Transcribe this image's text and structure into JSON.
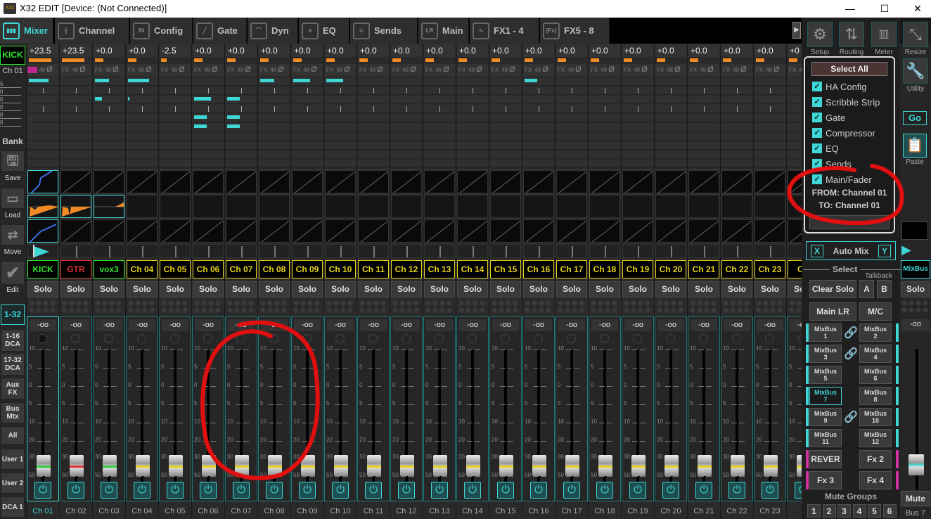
{
  "window": {
    "title": "X32 EDIT [Device: (Not Connected)]",
    "app_icon_text": "X32 EDIT",
    "minimize": "—",
    "maximize": "☐",
    "close": "✕"
  },
  "tabs": [
    {
      "label": "Mixer",
      "icon": "mixer-icon",
      "glyph": "▮▮▮",
      "active": true
    },
    {
      "label": "Channel",
      "icon": "channel-icon",
      "glyph": "╫"
    },
    {
      "label": "Config",
      "icon": "config-icon",
      "glyph": "IN"
    },
    {
      "label": "Gate",
      "icon": "gate-icon",
      "glyph": "╱"
    },
    {
      "label": "Dyn",
      "icon": "dyn-icon",
      "glyph": "⌒"
    },
    {
      "label": "EQ",
      "icon": "eq-icon",
      "glyph": "∧"
    },
    {
      "label": "Sends",
      "icon": "sends-icon",
      "glyph": "╪"
    },
    {
      "label": "Main",
      "icon": "main-icon",
      "glyph": "LR"
    },
    {
      "label": "FX1 - 4",
      "icon": "fx-wave-icon",
      "glyph": "∿"
    },
    {
      "label": "FX5 - 8",
      "icon": "fx-icon",
      "glyph": "(Fx)"
    }
  ],
  "sidebar": {
    "selected_name": "KICK",
    "selected_channel": "Ch 01",
    "meter_labels": [
      "5",
      "0",
      "0",
      "0",
      "0",
      "0"
    ],
    "bank": "Bank",
    "save": "Save",
    "load": "Load",
    "move": "Move",
    "edit": "Edit",
    "layers": [
      "1-32",
      "1-16 DCA",
      "17-32 DCA",
      "Aux FX",
      "Bus Mtx",
      "All",
      "User 1",
      "User 2",
      "DCA 1"
    ],
    "active_layer": "1-32"
  },
  "strip_common": {
    "fx_label": "FX",
    "rate": "48",
    "phase": "Ø",
    "solo": "Solo",
    "fader_value": "-oo",
    "scale": [
      "10",
      "5",
      "0",
      "5",
      "10",
      "20",
      "30",
      "50"
    ],
    "power": "⏻"
  },
  "channels": [
    {
      "gain": "+23.5",
      "trim": 0.8,
      "name": "KICK",
      "name_color": "#2ee82e",
      "label": "Ch 01",
      "cap": "#2ecc40",
      "sends": [
        [
          0,
          0.7
        ]
      ],
      "fx_active": true,
      "selected": true
    },
    {
      "gain": "+23.5",
      "trim": 0.8,
      "name": "GTR",
      "name_color": "#e03030",
      "label": "Ch 02",
      "cap": "#e03030",
      "sends": []
    },
    {
      "gain": "+0.0",
      "trim": 0.3,
      "name": "vox3",
      "name_color": "#2ee82e",
      "label": "Ch 03",
      "cap": "#2ecc40",
      "sends": [
        [
          0,
          0.5
        ],
        [
          2,
          0.25
        ]
      ]
    },
    {
      "gain": "+0.0",
      "trim": 0.3,
      "name": "Ch 04",
      "label": "Ch 04",
      "sends": [
        [
          0,
          0.75
        ],
        [
          2,
          0.05
        ]
      ]
    },
    {
      "gain": "-2.5",
      "trim": 0.2,
      "name": "Ch 05",
      "label": "Ch 05",
      "sends": []
    },
    {
      "gain": "+0.0",
      "trim": 0.3,
      "name": "Ch 06",
      "label": "Ch 06",
      "sends": [
        [
          2,
          0.6
        ],
        [
          4,
          0.45
        ],
        [
          5,
          0.45
        ]
      ]
    },
    {
      "gain": "+0.0",
      "trim": 0.3,
      "name": "Ch 07",
      "label": "Ch 07",
      "sends": [
        [
          2,
          0.45
        ],
        [
          4,
          0.45
        ],
        [
          5,
          0.45
        ]
      ]
    },
    {
      "gain": "+0.0",
      "trim": 0.3,
      "name": "Ch 08",
      "label": "Ch 08",
      "sends": [
        [
          0,
          0.5
        ]
      ]
    },
    {
      "gain": "+0.0",
      "trim": 0.3,
      "name": "Ch 09",
      "label": "Ch 09",
      "sends": [
        [
          0,
          0.6
        ]
      ]
    },
    {
      "gain": "+0.0",
      "trim": 0.3,
      "name": "Ch 10",
      "label": "Ch 10",
      "sends": [
        [
          0,
          0.6
        ]
      ]
    },
    {
      "gain": "+0.0",
      "trim": 0.3,
      "name": "Ch 11",
      "label": "Ch 11",
      "sends": []
    },
    {
      "gain": "+0.0",
      "trim": 0.3,
      "name": "Ch 12",
      "label": "Ch 12",
      "sends": []
    },
    {
      "gain": "+0.0",
      "trim": 0.3,
      "name": "Ch 13",
      "label": "Ch 13",
      "sends": []
    },
    {
      "gain": "+0.0",
      "trim": 0.3,
      "name": "Ch 14",
      "label": "Ch 14",
      "sends": []
    },
    {
      "gain": "+0.0",
      "trim": 0.3,
      "name": "Ch 15",
      "label": "Ch 15",
      "sends": []
    },
    {
      "gain": "+0.0",
      "trim": 0.3,
      "name": "Ch 16",
      "label": "Ch 16",
      "sends": [
        [
          0,
          0.45
        ]
      ]
    },
    {
      "gain": "+0.0",
      "trim": 0.3,
      "name": "Ch 17",
      "label": "Ch 17",
      "sends": []
    },
    {
      "gain": "+0.0",
      "trim": 0.3,
      "name": "Ch 18",
      "label": "Ch 18",
      "sends": []
    },
    {
      "gain": "+0.0",
      "trim": 0.3,
      "name": "Ch 19",
      "label": "Ch 19",
      "sends": []
    },
    {
      "gain": "+0.0",
      "trim": 0.3,
      "name": "Ch 20",
      "label": "Ch 20",
      "sends": []
    },
    {
      "gain": "+0.0",
      "trim": 0.3,
      "name": "Ch 21",
      "label": "Ch 21",
      "sends": []
    },
    {
      "gain": "+0.0",
      "trim": 0.3,
      "name": "Ch 22",
      "label": "Ch 22",
      "sends": []
    },
    {
      "gain": "+0.0",
      "trim": 0.3,
      "name": "Ch 23",
      "label": "Ch 23",
      "sends": []
    },
    {
      "gain": "+0",
      "trim": 0.3,
      "name": "Ch",
      "label": "",
      "sends": []
    }
  ],
  "right_panel": {
    "setup": "Setup",
    "routing": "Routing",
    "meter": "Meter",
    "resize": "Resize",
    "utility": "Utility",
    "go": "Go",
    "paste": "Paste",
    "copy_popup": {
      "select_all": "Select All",
      "options": [
        {
          "label": "HA Config",
          "checked": true
        },
        {
          "label": "Scribble Strip",
          "checked": true
        },
        {
          "label": "Gate",
          "checked": true
        },
        {
          "label": "Compressor",
          "checked": true
        },
        {
          "label": "EQ",
          "checked": true
        },
        {
          "label": "Sends",
          "checked": true
        },
        {
          "label": "Main/Fader",
          "checked": true
        }
      ],
      "from": "FROM: Channel 01",
      "to": "TO: Channel 01"
    },
    "automix": {
      "x": "X",
      "label": "Auto Mix",
      "y": "Y"
    },
    "select": "Select",
    "talkback": "Talkback",
    "clear_solo": "Clear Solo",
    "talk_a": "A",
    "talk_b": "B",
    "main_lr": "Main LR",
    "mc": "M/C",
    "buses": [
      [
        "MixBus\n1",
        "MixBus\n2"
      ],
      [
        "MixBus\n3",
        "MixBus\n4"
      ],
      [
        "MixBus\n5",
        "MixBus\n6"
      ],
      [
        "MixBus\n7",
        "MixBus\n8"
      ],
      [
        "MixBus\n9",
        "MixBus\n10"
      ],
      [
        "MixBus\n11",
        "MixBus\n12"
      ],
      [
        "REVER",
        "Fx 2"
      ],
      [
        "Fx 3",
        "Fx 4"
      ]
    ],
    "linked_rows": [
      0,
      1,
      4
    ],
    "selected_bus": "MixBus 7",
    "mute_groups_label": "Mute Groups",
    "mute_groups": [
      "1",
      "2",
      "3",
      "4",
      "5",
      "6"
    ]
  },
  "bus_strip": {
    "name": "MixBus 7",
    "solo": "Solo",
    "fader_value": "-oo",
    "mute": "Mute",
    "label": "Bus 7"
  },
  "colors": {
    "accent": "#3fd6d6",
    "trim": "#f08a24",
    "scribble_default": "#e6d21a",
    "annotation": "#e01010"
  }
}
